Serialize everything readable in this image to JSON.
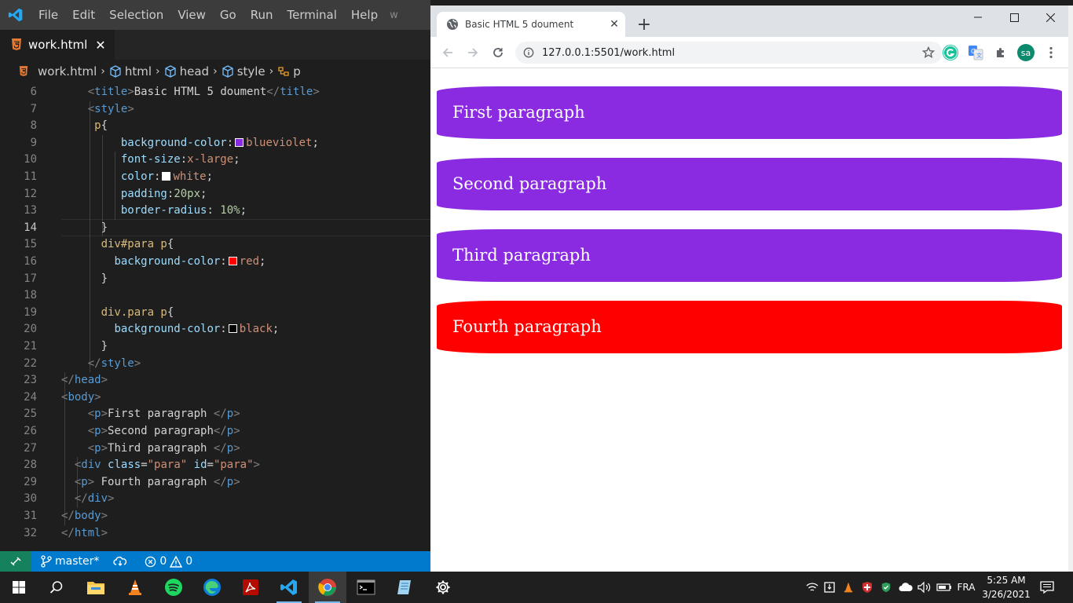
{
  "vscode": {
    "menu": [
      "File",
      "Edit",
      "Selection",
      "View",
      "Go",
      "Run",
      "Terminal",
      "Help"
    ],
    "title_fragment": "w",
    "tab": {
      "label": "work.html",
      "close": "✕"
    },
    "breadcrumb": [
      "work.html",
      "html",
      "head",
      "style",
      "p"
    ],
    "active_line": 14,
    "lines": [
      {
        "n": 6,
        "segs": [
          [
            "br",
            "<"
          ],
          [
            "tag",
            "title"
          ],
          [
            "br",
            ">"
          ],
          [
            "txt",
            "Basic HTML 5 doument"
          ],
          [
            "br",
            "</"
          ],
          [
            "tag",
            "title"
          ],
          [
            "br",
            ">"
          ]
        ],
        "indent": 4
      },
      {
        "n": 7,
        "segs": [
          [
            "br",
            "<"
          ],
          [
            "tag",
            "style"
          ],
          [
            "br",
            ">"
          ]
        ],
        "indent": 4
      },
      {
        "n": 8,
        "segs": [
          [
            "sel",
            "p"
          ],
          [
            "txt",
            "{"
          ]
        ],
        "indent": 5
      },
      {
        "n": 9,
        "segs": [
          [
            "prop",
            "background-color"
          ],
          [
            "txt",
            ":"
          ],
          [
            "sw",
            "#8a2be2"
          ],
          [
            "val",
            "blueviolet"
          ],
          [
            "txt",
            ";"
          ]
        ],
        "indent": 9
      },
      {
        "n": 10,
        "segs": [
          [
            "prop",
            "font-size"
          ],
          [
            "txt",
            ":"
          ],
          [
            "val",
            "x-large"
          ],
          [
            "txt",
            ";"
          ]
        ],
        "indent": 9
      },
      {
        "n": 11,
        "segs": [
          [
            "prop",
            "color"
          ],
          [
            "txt",
            ":"
          ],
          [
            "sw",
            "#ffffff"
          ],
          [
            "val",
            "white"
          ],
          [
            "txt",
            ";"
          ]
        ],
        "indent": 9
      },
      {
        "n": 12,
        "segs": [
          [
            "prop",
            "padding"
          ],
          [
            "txt",
            ":"
          ],
          [
            "num",
            "20px"
          ],
          [
            "txt",
            ";"
          ]
        ],
        "indent": 9
      },
      {
        "n": 13,
        "segs": [
          [
            "prop",
            "border-radius"
          ],
          [
            "txt",
            ": "
          ],
          [
            "num",
            "10%"
          ],
          [
            "txt",
            ";"
          ]
        ],
        "indent": 9
      },
      {
        "n": 14,
        "segs": [
          [
            "txt",
            "}"
          ]
        ],
        "indent": 6
      },
      {
        "n": 15,
        "segs": [
          [
            "sel",
            "div#para p"
          ],
          [
            "txt",
            "{"
          ]
        ],
        "indent": 6
      },
      {
        "n": 16,
        "segs": [
          [
            "prop",
            "background-color"
          ],
          [
            "txt",
            ":"
          ],
          [
            "sw",
            "#ff0000"
          ],
          [
            "val",
            "red"
          ],
          [
            "txt",
            ";"
          ]
        ],
        "indent": 8
      },
      {
        "n": 17,
        "segs": [
          [
            "txt",
            "}"
          ]
        ],
        "indent": 6
      },
      {
        "n": 18,
        "segs": [],
        "indent": 0
      },
      {
        "n": 19,
        "segs": [
          [
            "sel",
            "div.para p"
          ],
          [
            "txt",
            "{"
          ]
        ],
        "indent": 6
      },
      {
        "n": 20,
        "segs": [
          [
            "prop",
            "background-color"
          ],
          [
            "txt",
            ":"
          ],
          [
            "sw",
            "#000000"
          ],
          [
            "val",
            "black"
          ],
          [
            "txt",
            ";"
          ]
        ],
        "indent": 8
      },
      {
        "n": 21,
        "segs": [
          [
            "txt",
            "}"
          ]
        ],
        "indent": 6
      },
      {
        "n": 22,
        "segs": [
          [
            "br",
            "</"
          ],
          [
            "tag",
            "style"
          ],
          [
            "br",
            ">"
          ]
        ],
        "indent": 4
      },
      {
        "n": 23,
        "segs": [
          [
            "br",
            "</"
          ],
          [
            "tag",
            "head"
          ],
          [
            "br",
            ">"
          ]
        ],
        "indent": 0
      },
      {
        "n": 24,
        "segs": [
          [
            "br",
            "<"
          ],
          [
            "tag",
            "body"
          ],
          [
            "br",
            ">"
          ]
        ],
        "indent": 0
      },
      {
        "n": 25,
        "segs": [
          [
            "br",
            "<"
          ],
          [
            "tag",
            "p"
          ],
          [
            "br",
            ">"
          ],
          [
            "txt",
            "First paragraph "
          ],
          [
            "br",
            "</"
          ],
          [
            "tag",
            "p"
          ],
          [
            "br",
            ">"
          ]
        ],
        "indent": 4
      },
      {
        "n": 26,
        "segs": [
          [
            "br",
            "<"
          ],
          [
            "tag",
            "p"
          ],
          [
            "br",
            ">"
          ],
          [
            "txt",
            "Second paragraph"
          ],
          [
            "br",
            "</"
          ],
          [
            "tag",
            "p"
          ],
          [
            "br",
            ">"
          ]
        ],
        "indent": 4
      },
      {
        "n": 27,
        "segs": [
          [
            "br",
            "<"
          ],
          [
            "tag",
            "p"
          ],
          [
            "br",
            ">"
          ],
          [
            "txt",
            "Third paragraph "
          ],
          [
            "br",
            "</"
          ],
          [
            "tag",
            "p"
          ],
          [
            "br",
            ">"
          ]
        ],
        "indent": 4
      },
      {
        "n": 28,
        "segs": [
          [
            "br",
            "<"
          ],
          [
            "tag",
            "div"
          ],
          [
            "txt",
            " "
          ],
          [
            "attr",
            "class"
          ],
          [
            "txt",
            "="
          ],
          [
            "str",
            "\"para\""
          ],
          [
            "txt",
            " "
          ],
          [
            "attr",
            "id"
          ],
          [
            "txt",
            "="
          ],
          [
            "str",
            "\"para\""
          ],
          [
            "br",
            ">"
          ]
        ],
        "indent": 2
      },
      {
        "n": 29,
        "segs": [
          [
            "br",
            "<"
          ],
          [
            "tag",
            "p"
          ],
          [
            "br",
            ">"
          ],
          [
            "txt",
            " Fourth paragraph "
          ],
          [
            "br",
            "</"
          ],
          [
            "tag",
            "p"
          ],
          [
            "br",
            ">"
          ]
        ],
        "indent": 2
      },
      {
        "n": 30,
        "segs": [
          [
            "br",
            "</"
          ],
          [
            "tag",
            "div"
          ],
          [
            "br",
            ">"
          ]
        ],
        "indent": 2
      },
      {
        "n": 31,
        "segs": [
          [
            "br",
            "</"
          ],
          [
            "tag",
            "body"
          ],
          [
            "br",
            ">"
          ]
        ],
        "indent": 0
      },
      {
        "n": 32,
        "segs": [
          [
            "br",
            "</"
          ],
          [
            "tag",
            "html"
          ],
          [
            "br",
            ">"
          ]
        ],
        "indent": 0
      }
    ],
    "status": {
      "branch": "master*",
      "errors": "0",
      "warnings": "0"
    }
  },
  "chrome": {
    "tab_title": "Basic HTML 5 doument",
    "tab_close": "✕",
    "new_tab": "+",
    "url": "127.0.0.1:5501/work.html",
    "profile": "sa",
    "paragraphs": [
      {
        "text": "First paragraph",
        "color": "#8a2be2"
      },
      {
        "text": "Second paragraph",
        "color": "#8a2be2"
      },
      {
        "text": "Third paragraph",
        "color": "#8a2be2"
      },
      {
        "text": "Fourth paragraph",
        "color": "#ff0000"
      }
    ]
  },
  "taskbar": {
    "language": "FRA",
    "time": "5:25 AM",
    "date": "3/26/2021"
  },
  "colors": {
    "vscode_blue": "#007acc",
    "remote_green": "#16825d",
    "chrome_tabstrip": "#dee1e6"
  }
}
